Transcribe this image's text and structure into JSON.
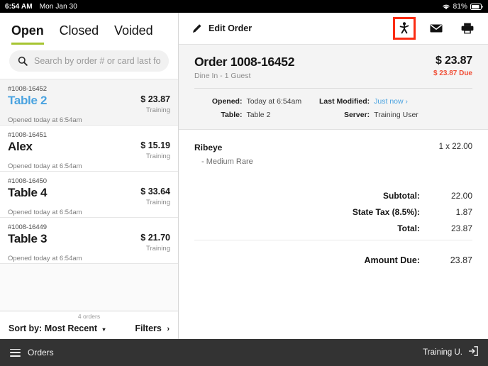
{
  "status_bar": {
    "time": "6:54 AM",
    "date": "Mon Jan 30",
    "battery_percent": "81%",
    "wifi_icon": "wifi-icon",
    "battery_icon": "battery-icon"
  },
  "left_panel": {
    "tabs": [
      {
        "label": "Open",
        "active": true
      },
      {
        "label": "Closed",
        "active": false
      },
      {
        "label": "Voided",
        "active": false
      }
    ],
    "search": {
      "placeholder": "Search by order # or card last four",
      "value": "",
      "icon": "search-icon"
    },
    "orders": [
      {
        "number": "#1008-16452",
        "title": "Table 2",
        "amount": "$ 23.87",
        "badge": "Training",
        "subtitle": "Opened today at 6:54am",
        "selected": true
      },
      {
        "number": "#1008-16451",
        "title": "Alex",
        "amount": "$ 15.19",
        "badge": "Training",
        "subtitle": "Opened today at 6:54am",
        "selected": false
      },
      {
        "number": "#1008-16450",
        "title": "Table 4",
        "amount": "$ 33.64",
        "badge": "Training",
        "subtitle": "Opened today at 6:54am",
        "selected": false
      },
      {
        "number": "#1008-16449",
        "title": "Table 3",
        "amount": "$ 21.70",
        "badge": "Training",
        "subtitle": "Opened today at 6:54am",
        "selected": false
      }
    ],
    "footer": {
      "count": "4 orders",
      "sort_label": "Sort by: Most Recent",
      "sort_caret": "▾",
      "filters_label": "Filters",
      "filters_chevron": "›"
    }
  },
  "right_panel": {
    "toolbar": {
      "edit_label": "Edit Order",
      "pencil_icon": "pencil-icon",
      "actions": [
        {
          "name": "transfer-person-icon",
          "highlighted": true
        },
        {
          "name": "envelope-icon",
          "highlighted": false
        },
        {
          "name": "printer-icon",
          "highlighted": false
        }
      ]
    },
    "order_header": {
      "title": "Order 1008-16452",
      "subtitle": "Dine In - 1 Guest",
      "total": "$ 23.87",
      "due": "$ 23.87 Due",
      "due_color": "#f04e36",
      "meta": {
        "opened_key": "Opened:",
        "opened_value": "Today at 6:54am",
        "table_key": "Table:",
        "table_value": "Table 2",
        "last_modified_key": "Last Modified:",
        "last_modified_value": "Just now",
        "last_modified_chevron": "›",
        "last_modified_color": "#4aa3e0",
        "server_key": "Server:",
        "server_value": "Training User"
      }
    },
    "items": [
      {
        "name": "Ribeye",
        "qty_price": "1 x 22.00",
        "modifier": "- Medium Rare"
      }
    ],
    "totals": [
      {
        "label": "Subtotal:",
        "value": "22.00"
      },
      {
        "label": "State Tax (8.5%):",
        "value": "1.87"
      },
      {
        "label": "Total:",
        "value": "23.87"
      }
    ],
    "amount_due": {
      "label": "Amount Due:",
      "value": "23.87"
    }
  },
  "bottom_bar": {
    "menu_icon": "hamburger-icon",
    "menu_label": "Orders",
    "user_label": "Training U.",
    "logout_icon": "logout-icon"
  },
  "theme": {
    "accent_green": "#a6c532",
    "accent_blue": "#4aa3e0",
    "alert_red": "#fb2c13",
    "bottom_bar_bg": "#333333"
  }
}
